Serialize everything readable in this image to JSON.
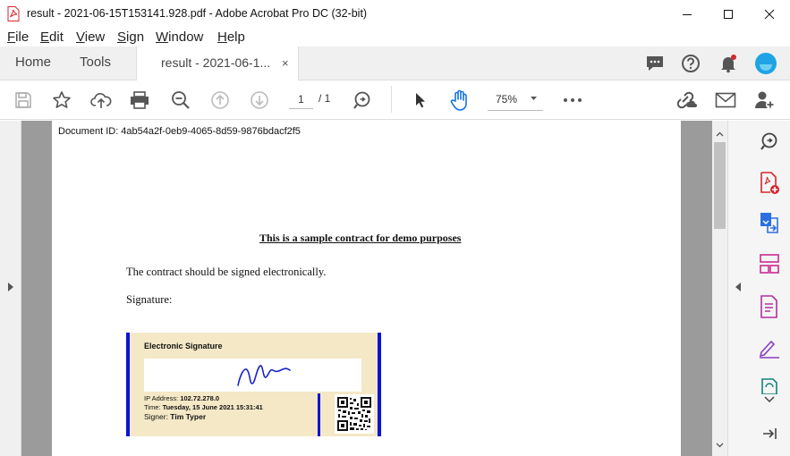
{
  "window": {
    "title": "result - 2021-06-15T153141.928.pdf - Adobe Acrobat Pro DC (32-bit)"
  },
  "menu": [
    {
      "first": "F",
      "rest": "ile"
    },
    {
      "first": "E",
      "rest": "dit"
    },
    {
      "first": "V",
      "rest": "iew"
    },
    {
      "first": "S",
      "rest": "ign"
    },
    {
      "first": "W",
      "rest": "indow"
    },
    {
      "first": "H",
      "rest": "elp"
    }
  ],
  "tabs": {
    "home": "Home",
    "tools": "Tools",
    "doc": "result - 2021-06-1...",
    "close": "×"
  },
  "toolbar": {
    "page_current": "1",
    "page_total": "/ 1",
    "zoom": "75%"
  },
  "document": {
    "doc_id": "Document ID: 4ab54a2f-0eb9-4065-8d59-9876bdacf2f5",
    "heading": "This is a sample contract for demo purposes",
    "body1": "The contract should be signed electronically.",
    "body2": "Signature:",
    "signature": {
      "title": "Electronic Signature",
      "ip_label": "IP Address: ",
      "ip_value": "102.72.278.0",
      "time_label": "Time: ",
      "time_value": "Tuesday, 15 June 2021 15:31:41",
      "signer_label": "Signer: ",
      "signer_value": "Tim Typer"
    }
  },
  "colors": {
    "acrobat_red": "#d7262e",
    "signature_blue": "#0a14d2",
    "signature_bg": "#f4e8c6",
    "avatar_blue": "#1fa3e4"
  }
}
